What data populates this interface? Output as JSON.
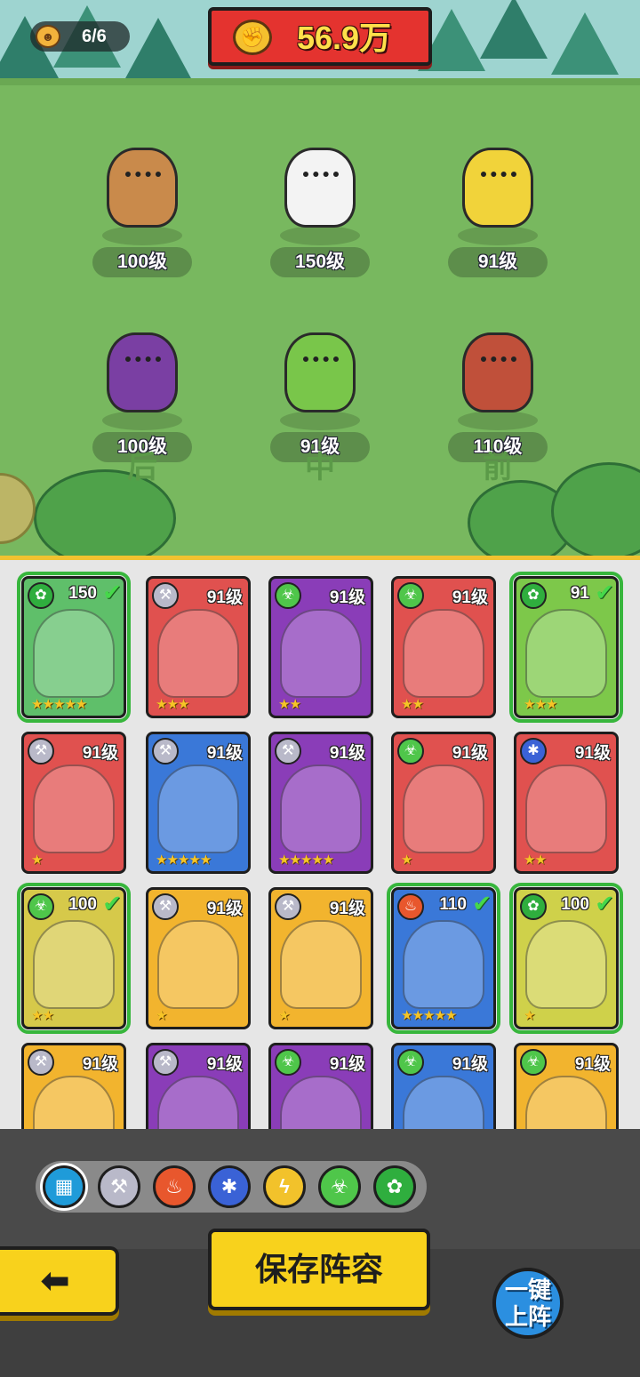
{
  "colors": {
    "elem_tech": "#b9b9c9",
    "elem_fire": "#e8572d",
    "elem_ice": "#3a62d6",
    "elem_thunder": "#f2c22b",
    "elem_poison": "#4fc64a",
    "elem_nature": "#2fae3e",
    "selected_outline": "#37b63c",
    "power_bg": "#e4332f",
    "button_yellow": "#f8d21c"
  },
  "header": {
    "capacity": "6/6",
    "power": "56.9万"
  },
  "formation": {
    "slots": [
      {
        "level": "100级",
        "hero_color": "#c98a4b",
        "icon": "deer-hero"
      },
      {
        "level": "150级",
        "hero_color": "#f3f3f3",
        "icon": "duck-hero"
      },
      {
        "level": "91级",
        "hero_color": "#f1d33a",
        "icon": "chicken-hero"
      },
      {
        "level": "100级",
        "hero_color": "#7a3fa3",
        "icon": "witch-hero"
      },
      {
        "level": "91级",
        "hero_color": "#79c64a",
        "icon": "dryad-hero"
      },
      {
        "level": "110级",
        "hero_color": "#c0503a",
        "icon": "pangolin-hero"
      }
    ],
    "row_labels": [
      "后",
      "中",
      "前"
    ]
  },
  "collection": {
    "cards": [
      {
        "level": "150",
        "bg": "#5fbf6a",
        "elem": "nature",
        "elem_color": "#2fae3e",
        "elem_glyph": "✿",
        "stars": "★★★★★",
        "selected": true
      },
      {
        "level": "91级",
        "bg": "#e0514f",
        "elem": "tech",
        "elem_color": "#b9b9c9",
        "elem_glyph": "⚒",
        "stars": "★★★",
        "selected": false
      },
      {
        "level": "91级",
        "bg": "#8a3db8",
        "elem": "poison",
        "elem_color": "#4fc64a",
        "elem_glyph": "☣",
        "stars": "★★",
        "selected": false
      },
      {
        "level": "91级",
        "bg": "#e0514f",
        "elem": "poison",
        "elem_color": "#4fc64a",
        "elem_glyph": "☣",
        "stars": "★★",
        "selected": false
      },
      {
        "level": "91",
        "bg": "#7dc84a",
        "elem": "nature",
        "elem_color": "#2fae3e",
        "elem_glyph": "✿",
        "stars": "★★★",
        "selected": true
      },
      {
        "level": "91级",
        "bg": "#e0514f",
        "elem": "tech",
        "elem_color": "#b9b9c9",
        "elem_glyph": "⚒",
        "stars": "★",
        "selected": false
      },
      {
        "level": "91级",
        "bg": "#3a78d8",
        "elem": "tech",
        "elem_color": "#b9b9c9",
        "elem_glyph": "⚒",
        "stars": "★★★★★",
        "selected": false
      },
      {
        "level": "91级",
        "bg": "#8a3db8",
        "elem": "tech",
        "elem_color": "#b9b9c9",
        "elem_glyph": "⚒",
        "stars": "★★★★★",
        "selected": false
      },
      {
        "level": "91级",
        "bg": "#e0514f",
        "elem": "poison",
        "elem_color": "#4fc64a",
        "elem_glyph": "☣",
        "stars": "★",
        "selected": false
      },
      {
        "level": "91级",
        "bg": "#e0514f",
        "elem": "ice",
        "elem_color": "#3a62d6",
        "elem_glyph": "✱",
        "stars": "★★",
        "selected": false
      },
      {
        "level": "100",
        "bg": "#d6c94a",
        "elem": "poison",
        "elem_color": "#4fc64a",
        "elem_glyph": "☣",
        "stars": "★★",
        "selected": true
      },
      {
        "level": "91级",
        "bg": "#f2b42e",
        "elem": "tech",
        "elem_color": "#b9b9c9",
        "elem_glyph": "⚒",
        "stars": "★",
        "selected": false
      },
      {
        "level": "91级",
        "bg": "#f2b42e",
        "elem": "tech",
        "elem_color": "#b9b9c9",
        "elem_glyph": "⚒",
        "stars": "★",
        "selected": false
      },
      {
        "level": "110",
        "bg": "#3a78d8",
        "elem": "fire",
        "elem_color": "#e8572d",
        "elem_glyph": "♨",
        "stars": "★★★★★",
        "selected": true
      },
      {
        "level": "100",
        "bg": "#cfd14a",
        "elem": "nature",
        "elem_color": "#2fae3e",
        "elem_glyph": "✿",
        "stars": "★",
        "selected": true
      },
      {
        "level": "91级",
        "bg": "#f2b42e",
        "elem": "tech",
        "elem_color": "#b9b9c9",
        "elem_glyph": "⚒",
        "stars": "",
        "selected": false
      },
      {
        "level": "91级",
        "bg": "#8a3db8",
        "elem": "tech",
        "elem_color": "#b9b9c9",
        "elem_glyph": "⚒",
        "stars": "",
        "selected": false
      },
      {
        "level": "91级",
        "bg": "#8a3db8",
        "elem": "poison",
        "elem_color": "#4fc64a",
        "elem_glyph": "☣",
        "stars": "",
        "selected": false
      },
      {
        "level": "91级",
        "bg": "#3a78d8",
        "elem": "poison",
        "elem_color": "#4fc64a",
        "elem_glyph": "☣",
        "stars": "",
        "selected": false
      },
      {
        "level": "91级",
        "bg": "#f2b42e",
        "elem": "poison",
        "elem_color": "#4fc64a",
        "elem_glyph": "☣",
        "stars": "",
        "selected": false
      }
    ]
  },
  "filters": [
    {
      "name": "all",
      "glyph": "▦",
      "color": "#1f9bd9",
      "active": true
    },
    {
      "name": "tech",
      "glyph": "⚒",
      "color": "#b9b9c9",
      "active": false
    },
    {
      "name": "fire",
      "glyph": "♨",
      "color": "#e8572d",
      "active": false
    },
    {
      "name": "ice",
      "glyph": "✱",
      "color": "#3a62d6",
      "active": false
    },
    {
      "name": "thunder",
      "glyph": "ϟ",
      "color": "#f2c22b",
      "active": false
    },
    {
      "name": "poison",
      "glyph": "☣",
      "color": "#4fc64a",
      "active": false
    },
    {
      "name": "nature",
      "glyph": "✿",
      "color": "#2fae3e",
      "active": false
    }
  ],
  "actions": {
    "back_glyph": "⬅",
    "save_label": "保存阵容",
    "auto_label_1": "一键",
    "auto_label_2": "上阵"
  }
}
